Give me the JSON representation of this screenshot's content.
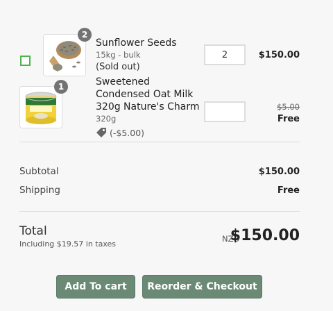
{
  "items": [
    {
      "name": "Sunflower Seeds",
      "variant": "15kg - bulk",
      "status": "(Sold out)",
      "badge": "2",
      "quantity": "2",
      "price": "$150.00",
      "icon": "sunflower-seeds-image"
    },
    {
      "name_lines": [
        "Sweetened",
        "Condensed Oat Milk",
        "320g Nature's Charm"
      ],
      "variant": "320g",
      "discount": "(-$5.00)",
      "badge": "1",
      "quantity": "",
      "original_price": "$5.00",
      "price": "Free",
      "icon": "oat-milk-can-image"
    }
  ],
  "summary": {
    "subtotal_label": "Subtotal",
    "subtotal_value": "$150.00",
    "shipping_label": "Shipping",
    "shipping_value": "Free",
    "total_label": "Total",
    "tax_note": "Including $19.57 in taxes",
    "currency": "NZD",
    "total_value": "$150.00"
  },
  "buttons": {
    "add_to_cart": "Add To cart",
    "reorder": "Reorder & Checkout"
  },
  "colors": {
    "button_bg": "#6a8a76",
    "checkbox_border": "#4bb54b",
    "badge_bg": "#737373"
  }
}
